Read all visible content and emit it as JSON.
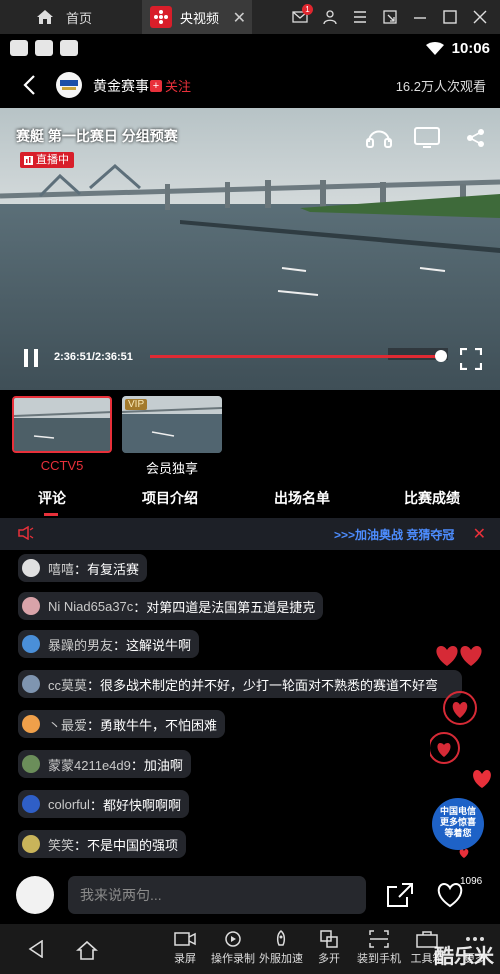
{
  "emulator_tabs": {
    "home_label": "首页",
    "active_label": "央视频",
    "notification_count": "1"
  },
  "status_bar": {
    "time": "10:06"
  },
  "header": {
    "channel_name": "黄金赛事",
    "follow_label": "关注",
    "viewers": "16.2万人次观看"
  },
  "video": {
    "title": "赛艇 第一比赛日 分组预赛",
    "live_label": "直播中",
    "time": "2:36:51/2:36:51",
    "progress": 0.99
  },
  "sources": [
    {
      "label": "CCTV5",
      "selected": true
    },
    {
      "label": "会员独享",
      "badge": "VIP",
      "selected": false
    }
  ],
  "tabs": [
    "评论",
    "项目介绍",
    "出场名单",
    "比赛成绩"
  ],
  "marquee": {
    "text": ">>>加油奥战 竞猜夺冠"
  },
  "comments": [
    {
      "nick": "嘻嘻",
      "text": "有复活赛",
      "avatar_color": "#e0e0e0"
    },
    {
      "nick": "Ni Niad65a37c",
      "text": "对第四道是法国第五道是捷克",
      "avatar_color": "#d9a3a9"
    },
    {
      "nick": "暴躁的男友 ",
      "text": "这解说牛啊",
      "avatar_color": "#4a8fd8"
    },
    {
      "nick": "cc莫莫",
      "text": "很多战术制定的并不好，少打一轮面对不熟悉的赛道不好弯",
      "avatar_color": "#7f95b0"
    },
    {
      "nick": "丶最爱",
      "text": "勇敢牛牛，不怕困难",
      "avatar_color": "#f0a04a"
    },
    {
      "nick": "蒙蒙4211e4d9",
      "text": "加油啊",
      "avatar_color": "#6b8e5a"
    },
    {
      "nick": "colorful",
      "text": "都好快啊啊啊",
      "avatar_color": "#2f5fc7"
    },
    {
      "nick": "笑笑",
      "text": "不是中国的强项",
      "avatar_color": "#c9b45a"
    }
  ],
  "promo": {
    "line1": "中国电信",
    "line2": "更多惊喜",
    "line3": "等着您"
  },
  "input": {
    "placeholder": "我来说两句...",
    "like_count": "1096"
  },
  "toolbar": {
    "items": [
      "录屏",
      "操作录制",
      "外服加速",
      "多开",
      "装到手机",
      "工具箱",
      "更多"
    ]
  },
  "watermark": "酷乐米",
  "colors": {
    "accent": "#e8303a",
    "marquee": "#4d8dff",
    "background": "#000000"
  }
}
